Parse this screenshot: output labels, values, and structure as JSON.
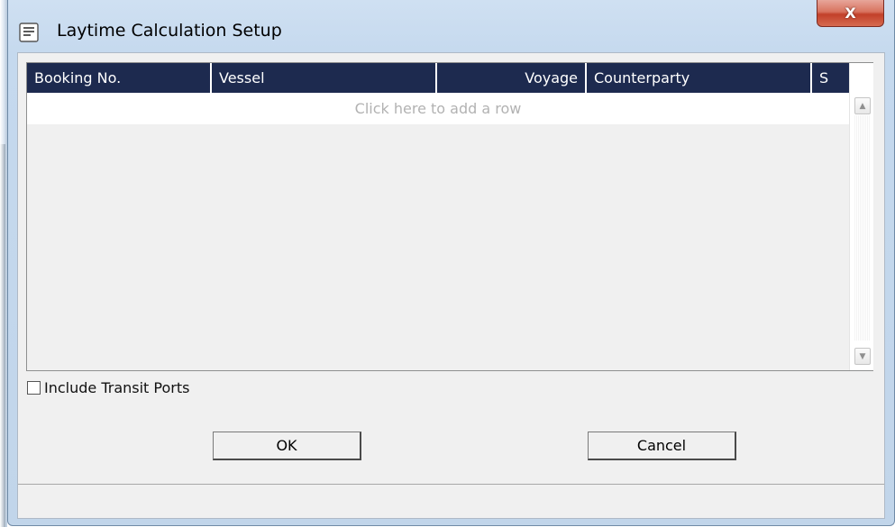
{
  "window": {
    "title": "Laytime Calculation Setup",
    "close_label": "X"
  },
  "grid": {
    "columns": [
      "Booking No.",
      "Vessel",
      "Voyage",
      "Counterparty",
      "S"
    ],
    "add_row_label": "Click here to add a row"
  },
  "options": {
    "include_transit_ports_label": "Include Transit Ports",
    "include_transit_ports_checked": false
  },
  "buttons": {
    "ok_label": "OK",
    "cancel_label": "Cancel"
  },
  "colors": {
    "header_bg": "#1d2a4f",
    "close_red": "#c2402a",
    "window_frame": "#c5d9ee"
  }
}
